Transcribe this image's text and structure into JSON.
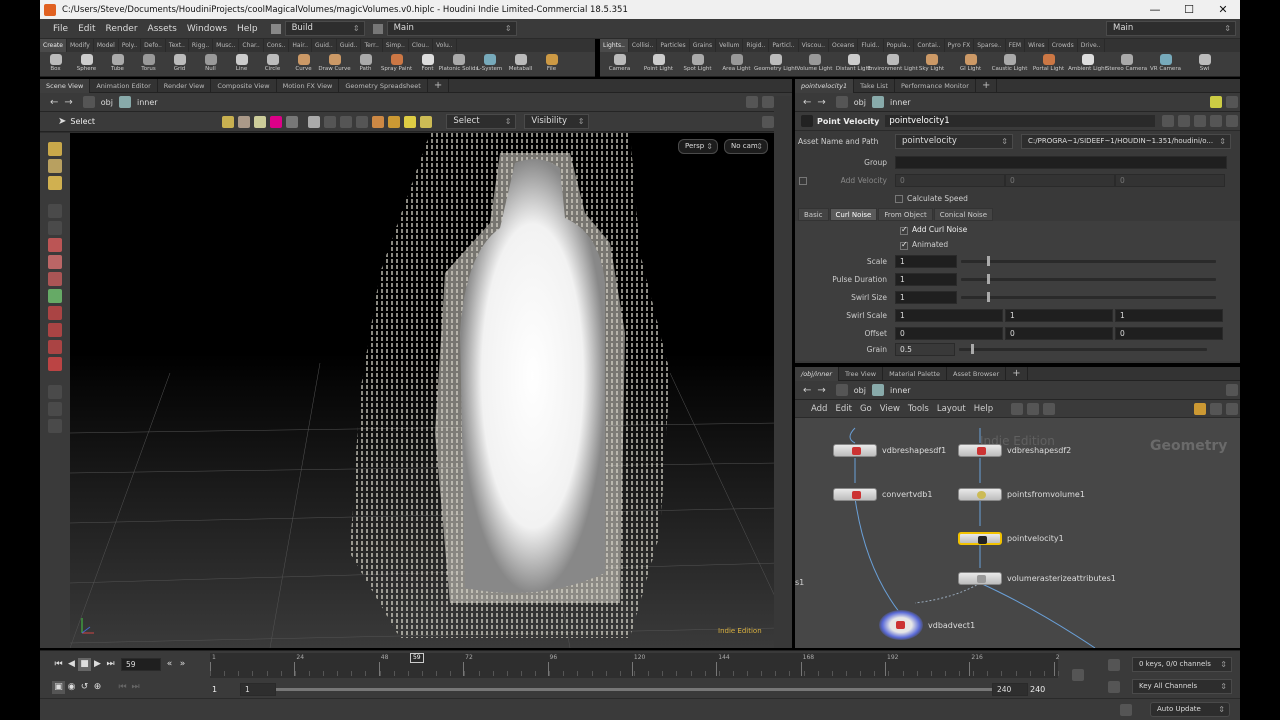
{
  "window": {
    "title": "C:/Users/Steve/Documents/HoudiniProjects/coolMagicalVolumes/magicVolumes.v0.hiplc - Houdini Indie Limited-Commercial 18.5.351"
  },
  "menu": {
    "items": [
      "File",
      "Edit",
      "Render",
      "Assets",
      "Windows",
      "Help"
    ],
    "desktop": "Build",
    "main": "Main",
    "right_main": "Main"
  },
  "shelf_tabs_left": [
    "Create",
    "Modify",
    "Model",
    "Poly..",
    "Defo..",
    "Text..",
    "Rigg..",
    "Musc..",
    "Char..",
    "Cons..",
    "Hair..",
    "Guid..",
    "Guid..",
    "Terr..",
    "Simp..",
    "Clou..",
    "Volu.."
  ],
  "shelf_tools_left": [
    "Box",
    "Sphere",
    "Tube",
    "Torus",
    "Grid",
    "Null",
    "Line",
    "Circle",
    "Curve",
    "Draw Curve",
    "Path",
    "Spray Paint",
    "Font",
    "Platonic Solids",
    "L-System",
    "Metaball",
    "File"
  ],
  "shelf_tabs_right": [
    "Lights..",
    "Collisi..",
    "Particles",
    "Grains",
    "Vellum",
    "Rigid..",
    "Particl..",
    "Viscou..",
    "Oceans",
    "Fluid..",
    "Popula..",
    "Contai..",
    "Pyro FX",
    "Sparse..",
    "FEM",
    "Wires",
    "Crowds",
    "Drive.."
  ],
  "shelf_tools_right": [
    "Camera",
    "Point Light",
    "Spot Light",
    "Area Light",
    "Geometry Light",
    "Volume Light",
    "Distant Light",
    "Environment Light",
    "Sky Light",
    "GI Light",
    "Caustic Light",
    "Portal Light",
    "Ambient Light",
    "Stereo Camera",
    "VR Camera",
    "Swi"
  ],
  "left_pane": {
    "tabs": [
      "Scene View",
      "Animation Editor",
      "Render View",
      "Composite View",
      "Motion FX View",
      "Geometry Spreadsheet"
    ],
    "path": [
      "obj",
      "inner"
    ],
    "tool_label": "Select",
    "select_dd": "Select",
    "visibility_dd": "Visibility",
    "persp": "Persp",
    "cam": "No cam",
    "edition": "Indie Edition"
  },
  "params": {
    "tabs": [
      "pointvelocity1",
      "Take List",
      "Performance Monitor"
    ],
    "path": [
      "obj",
      "inner"
    ],
    "node_type": "Point Velocity",
    "node_name": "pointvelocity1",
    "asset_label": "Asset Name and Path",
    "asset_value": "pointvelocity",
    "asset_path": "C:/PROGRA~1/SIDEEF~1/HOUDIN~1.351/houdini/o...",
    "group_label": "Group",
    "add_velocity_label": "Add Velocity",
    "add_velocity_vals": [
      "0",
      "0",
      "0"
    ],
    "calc_speed": "Calculate Speed",
    "subtabs": [
      "Basic",
      "Curl Noise",
      "From Object",
      "Conical Noise"
    ],
    "add_curl": "Add Curl Noise",
    "animated": "Animated",
    "rows": [
      {
        "label": "Scale",
        "value": "1",
        "knob": 0.1
      },
      {
        "label": "Pulse Duration",
        "value": "1",
        "knob": 0.1
      },
      {
        "label": "Swirl Size",
        "value": "1",
        "knob": 0.1
      }
    ],
    "swirl_scale": {
      "label": "Swirl Scale",
      "values": [
        "1",
        "1",
        "1"
      ]
    },
    "offset": {
      "label": "Offset",
      "values": [
        "0",
        "0",
        "0"
      ]
    },
    "grain": {
      "label": "Grain",
      "value": "0.5",
      "knob": 0.05
    }
  },
  "network": {
    "tabs": [
      "/obj/inner",
      "Tree View",
      "Material Palette",
      "Asset Browser"
    ],
    "path": [
      "obj",
      "inner"
    ],
    "menu": [
      "Add",
      "Edit",
      "Go",
      "View",
      "Tools",
      "Layout",
      "Help"
    ],
    "watermark_edition": "Indie Edition",
    "watermark_context": "Geometry",
    "side_fragment": "s1",
    "nodes": {
      "n1": "vdbreshapesdf1",
      "n2": "vdbreshapesdf2",
      "n3": "convertvdb1",
      "n4": "pointsfromvolume1",
      "n5": "pointvelocity1",
      "n6": "volumerasterizeattributes1",
      "n7": "vdbadvect1"
    }
  },
  "timeline": {
    "frame": "59",
    "ticks": [
      "1",
      "24",
      "48",
      "72",
      "96",
      "120",
      "144",
      "168",
      "192",
      "216",
      "2"
    ],
    "cursor": "59",
    "start": "1",
    "start2": "1",
    "end": "240",
    "end2": "240",
    "keys_info": "0 keys, 0/0 channels",
    "key_channels": "Key All Channels",
    "auto_update": "Auto Update"
  }
}
